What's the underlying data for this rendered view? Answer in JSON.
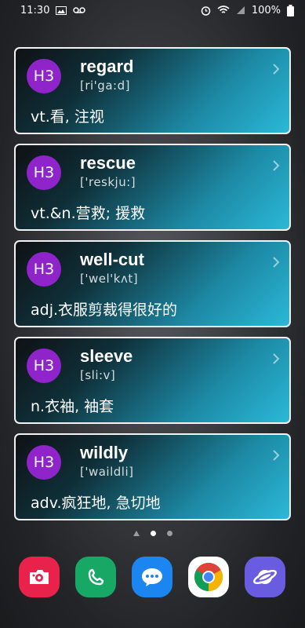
{
  "status_bar": {
    "time": "11:30",
    "battery": "100%",
    "left_icons": [
      "image-icon",
      "voicemail-icon"
    ],
    "right_icons": [
      "alarm-icon",
      "wifi-icon",
      "signal-icon",
      "battery-icon"
    ]
  },
  "cards": [
    {
      "badge": "H3",
      "word": "regard",
      "phonetic": "[ri'ga:d]",
      "meaning": "vt.看, 注视"
    },
    {
      "badge": "H3",
      "word": "rescue",
      "phonetic": "['reskju:]",
      "meaning": "vt.&n.营救; 援救"
    },
    {
      "badge": "H3",
      "word": "well-cut",
      "phonetic": "['wel'kʌt]",
      "meaning": "adj.衣服剪裁得很好的"
    },
    {
      "badge": "H3",
      "word": "sleeve",
      "phonetic": "[sli:v]",
      "meaning": "n.衣袖, 袖套"
    },
    {
      "badge": "H3",
      "word": "wildly",
      "phonetic": "['waildli]",
      "meaning": "adv.疯狂地, 急切地"
    }
  ],
  "page_indicator": {
    "pages": 3,
    "active": 2
  },
  "dock": [
    {
      "name": "screen-recorder-app",
      "color": "#e8224a"
    },
    {
      "name": "phone-app",
      "color": "#17a866"
    },
    {
      "name": "messages-app",
      "color": "#1c86f0"
    },
    {
      "name": "chrome-app",
      "color": "#ffffff"
    },
    {
      "name": "internet-app",
      "color": "#6a5ce0"
    }
  ]
}
